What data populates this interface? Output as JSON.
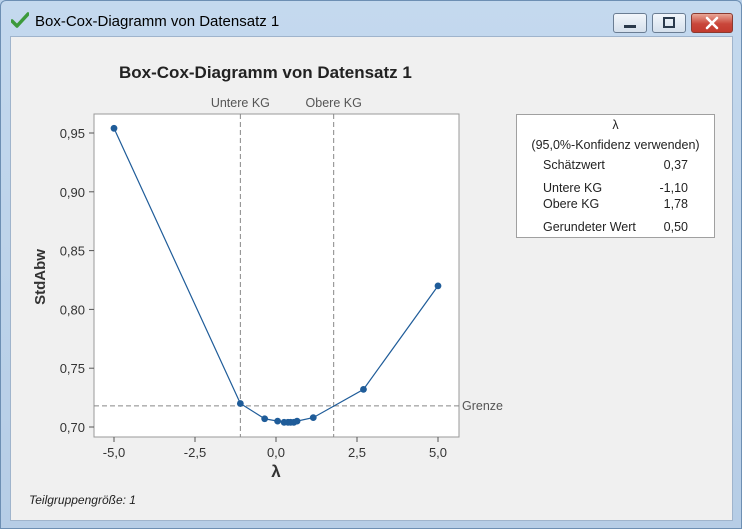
{
  "window": {
    "title": "Box-Cox-Diagramm von Datensatz 1",
    "minimize_icon": "minimize-icon",
    "maximize_icon": "maximize-icon",
    "close_icon": "close-icon"
  },
  "chart_title": "Box-Cox-Diagramm von Datensatz 1",
  "chart_data": {
    "type": "line",
    "title": "Box-Cox-Diagramm von Datensatz 1",
    "xlabel": "λ",
    "ylabel": "StdAbw",
    "xlim": [
      -5.5,
      5.5
    ],
    "ylim": [
      0.69,
      0.965
    ],
    "xticks": [
      -5.0,
      -2.5,
      0.0,
      2.5,
      5.0
    ],
    "xtick_labels": [
      "-5,0",
      "-2,5",
      "0,0",
      "2,5",
      "5,0"
    ],
    "yticks": [
      0.7,
      0.75,
      0.8,
      0.85,
      0.9,
      0.95
    ],
    "ytick_labels": [
      "0,70",
      "0,75",
      "0,80",
      "0,85",
      "0,90",
      "0,95"
    ],
    "series": [
      {
        "x": [
          -5.0,
          -1.1,
          -0.35,
          0.05,
          0.25,
          0.37,
          0.45,
          0.55,
          0.65,
          1.15,
          2.7,
          5.0
        ],
        "y": [
          0.954,
          0.72,
          0.707,
          0.705,
          0.704,
          0.704,
          0.704,
          0.704,
          0.705,
          0.708,
          0.732,
          0.82
        ]
      }
    ],
    "vlines": [
      {
        "x": -1.1,
        "label": "Untere KG"
      },
      {
        "x": 1.78,
        "label": "Obere KG"
      }
    ],
    "hline": {
      "y": 0.718,
      "label": "Grenze"
    },
    "color": "#1f5c99",
    "grid": false
  },
  "legend": {
    "header": "λ",
    "subheader": "(95,0%-Konfidenz verwenden)",
    "rows": [
      {
        "label": "Schätzwert",
        "value": "0,37"
      },
      {
        "label": "Untere KG",
        "value": "-1,10"
      },
      {
        "label": "Obere KG",
        "value": "1,78"
      },
      {
        "label": "Gerundeter Wert",
        "value": "0,50"
      }
    ]
  },
  "footnote": "Teilgruppengröße: 1"
}
